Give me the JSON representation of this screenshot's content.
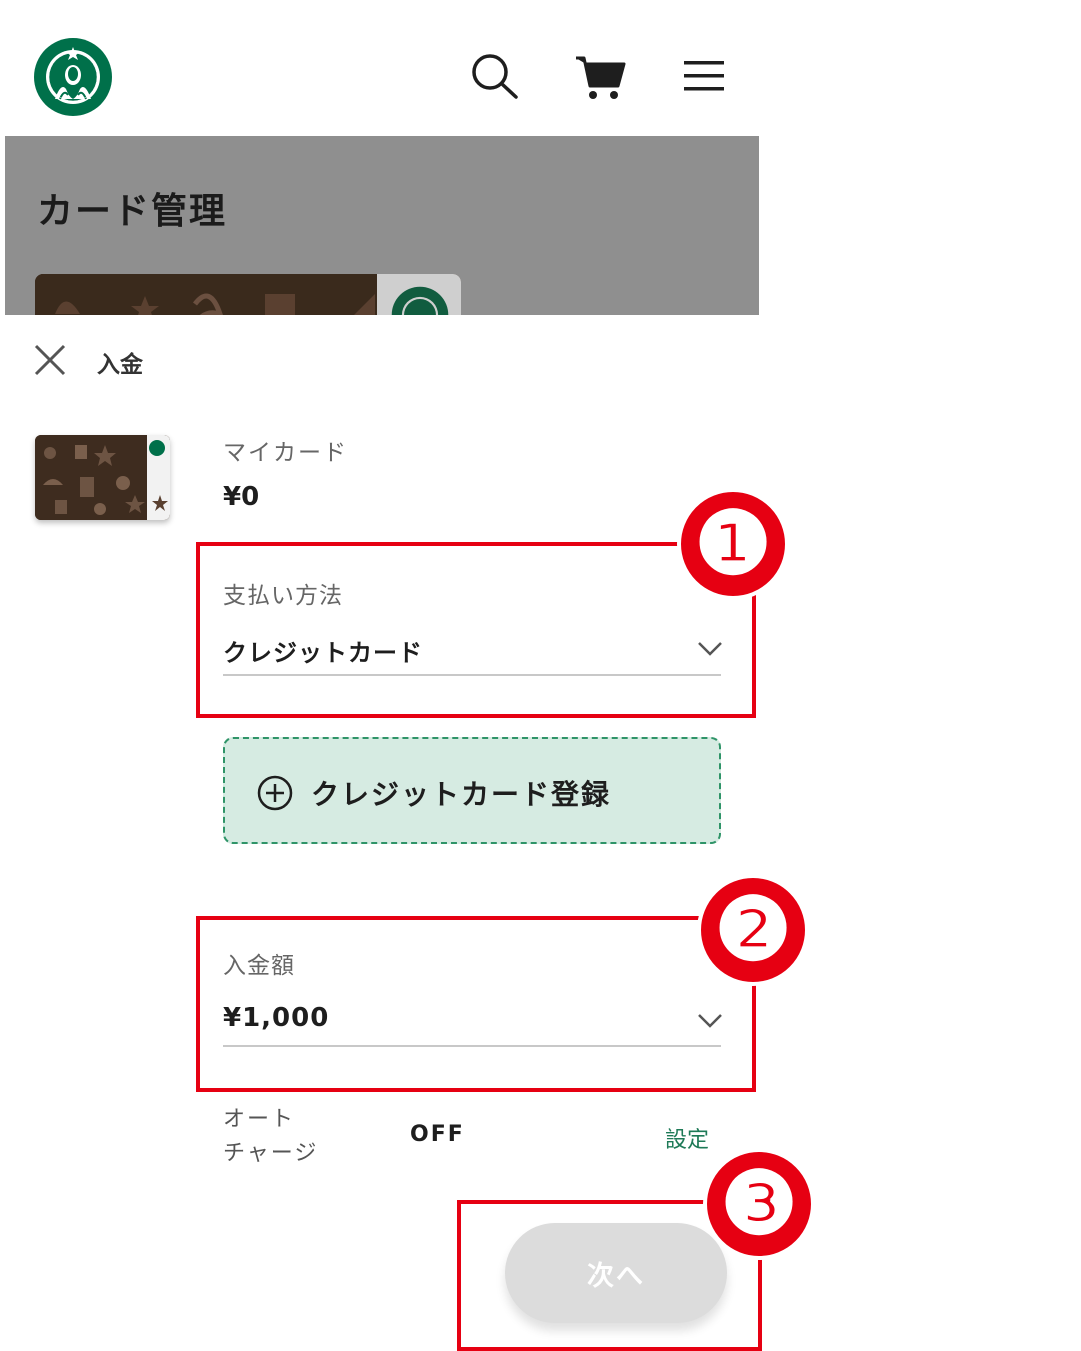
{
  "header": {
    "logo_icon": "starbucks-siren-logo",
    "icons": [
      "search-icon",
      "cart-icon",
      "hamburger-menu-icon"
    ]
  },
  "background_page": {
    "title": "カード管理"
  },
  "sheet": {
    "title": "入金",
    "card": {
      "label": "マイカード",
      "balance": "¥0"
    },
    "payment_method": {
      "label": "支払い方法",
      "value": "クレジットカード"
    },
    "add_credit_card": {
      "label": "クレジットカード登録"
    },
    "amount": {
      "label": "入金額",
      "value": "¥1,000"
    },
    "auto_charge": {
      "label_line1": "オート",
      "label_line2": "チャージ",
      "value": "OFF",
      "link": "設定"
    },
    "next_button": "次へ"
  },
  "annotations": {
    "badges": [
      "❶",
      "❷",
      "❸"
    ],
    "color": "#e60012"
  },
  "colors": {
    "brand_green": "#00704a",
    "add_card_bg": "#d6ebe2",
    "link_green": "#1e7a57",
    "disabled_button": "#dcdcdc"
  }
}
